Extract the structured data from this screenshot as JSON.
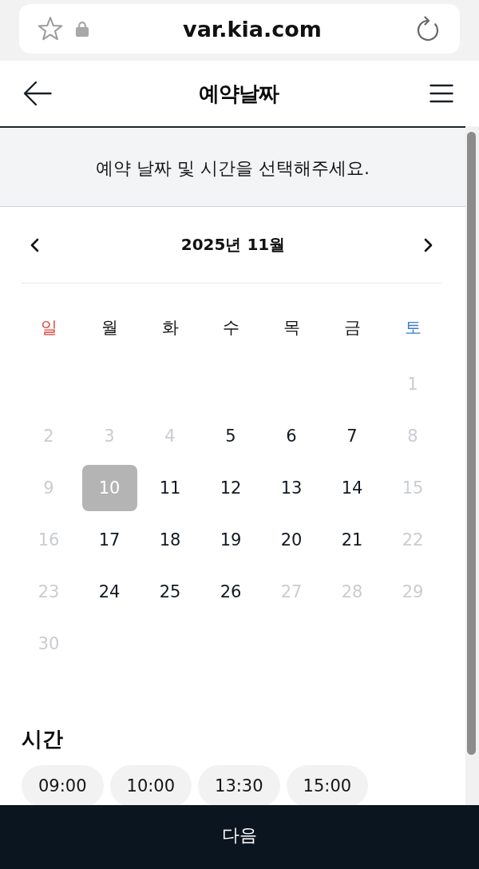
{
  "browser": {
    "url": "var.kia.com"
  },
  "header": {
    "title": "예약날짜"
  },
  "notice": "예약 날짜 및 시간을 선택해주세요.",
  "calendar": {
    "month": "2025년 11월",
    "weekdays": [
      {
        "label": "일",
        "color": "#e0463e"
      },
      {
        "label": "월",
        "color": "#111111"
      },
      {
        "label": "화",
        "color": "#111111"
      },
      {
        "label": "수",
        "color": "#111111"
      },
      {
        "label": "목",
        "color": "#111111"
      },
      {
        "label": "금",
        "color": "#111111"
      },
      {
        "label": "토",
        "color": "#3d7bd6"
      }
    ],
    "weeks": [
      [
        {
          "day": "1",
          "disabled": true,
          "selected": false
        }
      ],
      [
        {
          "day": "2",
          "disabled": true,
          "selected": false
        },
        {
          "day": "3",
          "disabled": true,
          "selected": false
        },
        {
          "day": "4",
          "disabled": true,
          "selected": false
        },
        {
          "day": "5",
          "disabled": false,
          "selected": false
        },
        {
          "day": "6",
          "disabled": false,
          "selected": false
        },
        {
          "day": "7",
          "disabled": false,
          "selected": false
        },
        {
          "day": "8",
          "disabled": true,
          "selected": false
        }
      ],
      [
        {
          "day": "9",
          "disabled": true,
          "selected": false
        },
        {
          "day": "10",
          "disabled": false,
          "selected": true
        },
        {
          "day": "11",
          "disabled": false,
          "selected": false
        },
        {
          "day": "12",
          "disabled": false,
          "selected": false
        },
        {
          "day": "13",
          "disabled": false,
          "selected": false
        },
        {
          "day": "14",
          "disabled": false,
          "selected": false
        },
        {
          "day": "15",
          "disabled": true,
          "selected": false
        }
      ],
      [
        {
          "day": "16",
          "disabled": true,
          "selected": false
        },
        {
          "day": "17",
          "disabled": false,
          "selected": false
        },
        {
          "day": "18",
          "disabled": false,
          "selected": false
        },
        {
          "day": "19",
          "disabled": false,
          "selected": false
        },
        {
          "day": "20",
          "disabled": false,
          "selected": false
        },
        {
          "day": "21",
          "disabled": false,
          "selected": false
        },
        {
          "day": "22",
          "disabled": true,
          "selected": false
        }
      ],
      [
        {
          "day": "23",
          "disabled": true,
          "selected": false
        },
        {
          "day": "24",
          "disabled": false,
          "selected": false
        },
        {
          "day": "25",
          "disabled": false,
          "selected": false
        },
        {
          "day": "26",
          "disabled": false,
          "selected": false
        },
        {
          "day": "27",
          "disabled": true,
          "selected": false
        },
        {
          "day": "28",
          "disabled": true,
          "selected": false
        },
        {
          "day": "29",
          "disabled": true,
          "selected": false
        }
      ],
      [
        {
          "day": "30",
          "disabled": true,
          "selected": false
        }
      ]
    ]
  },
  "time": {
    "heading": "시간",
    "slots": [
      {
        "label": "09:00",
        "selected": false
      },
      {
        "label": "10:00",
        "selected": false
      },
      {
        "label": "13:30",
        "selected": false
      },
      {
        "label": "15:00",
        "selected": false
      }
    ]
  },
  "footer": {
    "next": "다음"
  }
}
